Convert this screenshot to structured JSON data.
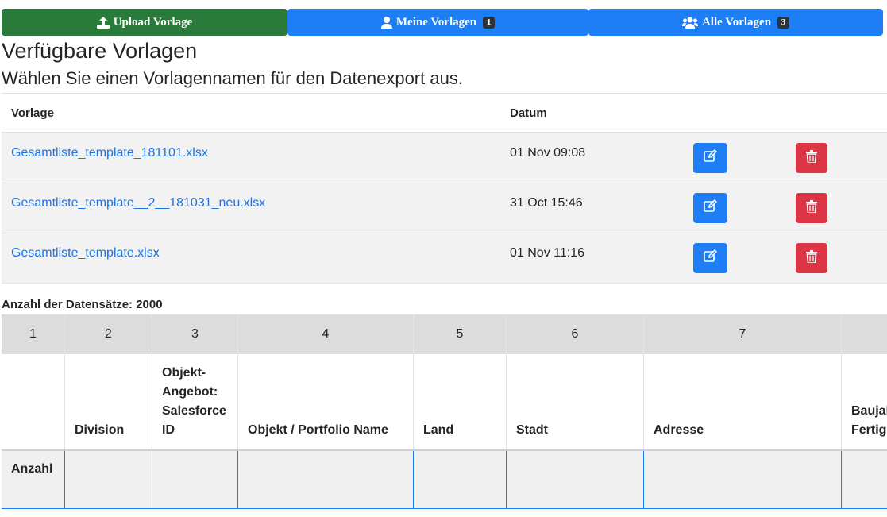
{
  "tabs": {
    "upload": "Upload Vorlage",
    "mine": "Meine Vorlagen",
    "mine_badge": "1",
    "all": "Alle Vorlagen",
    "all_badge": "3"
  },
  "title": "Verfügbare Vorlagen",
  "subtitle": "Wählen Sie einen Vorlagennamen für den Datenexport aus.",
  "templates": {
    "col_vorlage": "Vorlage",
    "col_datum": "Datum",
    "rows": [
      {
        "name": "Gesamtliste_template_181101.xlsx",
        "date": "01 Nov 09:08"
      },
      {
        "name": "Gesamtliste_template__2__181031_neu.xlsx",
        "date": "31 Oct 15:46"
      },
      {
        "name": "Gesamtliste_template.xlsx",
        "date": "01 Nov 11:16"
      }
    ]
  },
  "record_count": "Anzahl der Datensätze: 2000",
  "grid": {
    "numbers": [
      "1",
      "2",
      "3",
      "4",
      "5",
      "6",
      "7"
    ],
    "headers": [
      "",
      "Division",
      "Objekt-Angebot: Salesforce ID",
      "Objekt / Portfolio Name",
      "Land",
      "Stadt",
      "Adresse",
      "Baujahr Fertig"
    ],
    "count_label": "Anzahl"
  },
  "colors": {
    "upload": "#2a7a3b",
    "primary": "#1e7ef5",
    "danger": "#dc3545",
    "link": "#1a73e8"
  },
  "icons": {
    "upload": "upload-icon",
    "user": "user-icon",
    "users": "users-icon",
    "edit": "edit-icon",
    "delete": "trash-icon"
  }
}
